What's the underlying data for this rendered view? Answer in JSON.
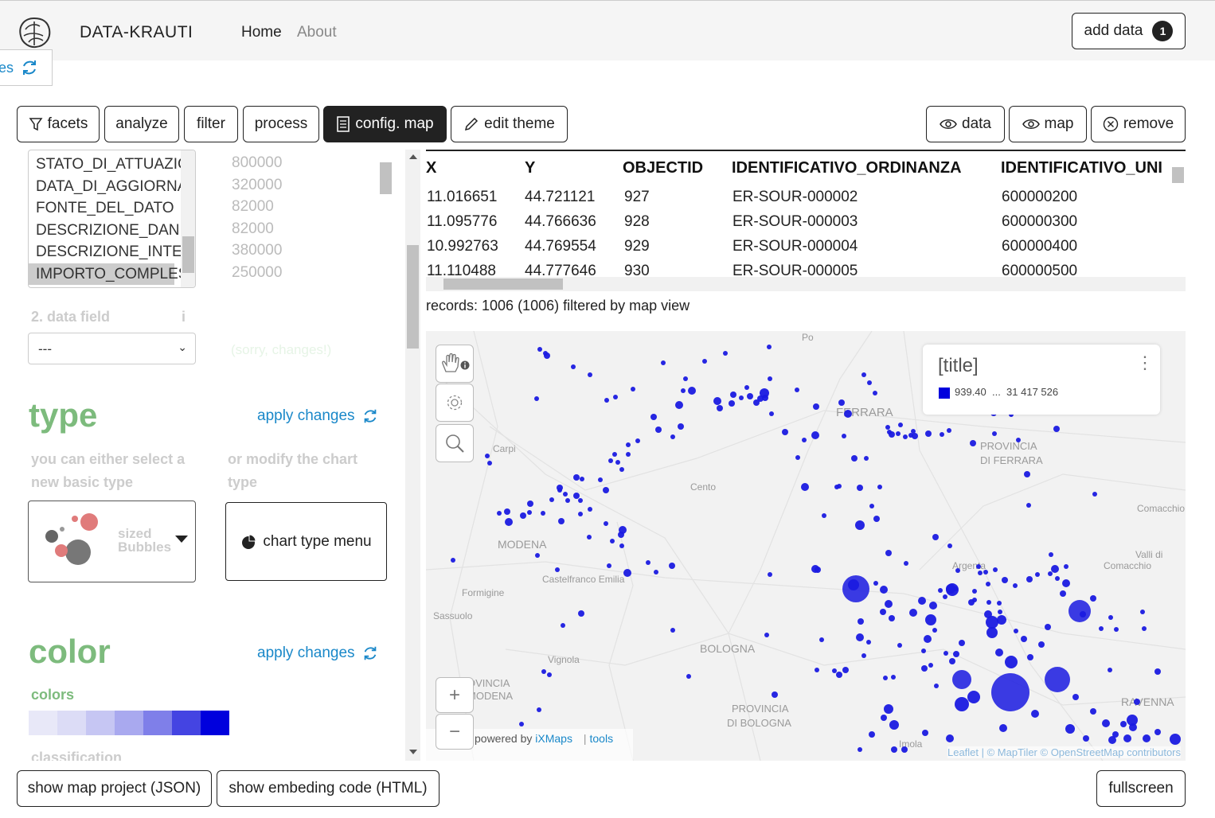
{
  "header": {
    "brand": "DATA-KRAUTI",
    "nav": [
      "Home",
      "About"
    ],
    "add_data_label": "add data",
    "add_data_count": "1",
    "side_tab_label": "es"
  },
  "toolbar": {
    "facets": "facets",
    "analyze": "analyze",
    "filter": "filter",
    "process": "process",
    "config_map": "config. map",
    "edit_theme": "edit theme",
    "data": "data",
    "map": "map",
    "remove": "remove"
  },
  "fields": {
    "items": [
      "STATO_DI_ATTUAZIC",
      "DATA_DI_AGGIORNA",
      "FONTE_DEL_DATO",
      "DESCRIZIONE_DANN",
      "DESCRIZIONE_INTER",
      "IMPORTO_COMPLES"
    ],
    "values": [
      "800000",
      "320000",
      "82000",
      "82000",
      "380000",
      "250000"
    ],
    "data_field_label": "2. data field",
    "info_icon": "i",
    "select_value": "---",
    "faded_hint": "(sorry, changes!)"
  },
  "type_section": {
    "title": "type",
    "apply": "apply changes",
    "hint_left": "you can either select a new basic type",
    "hint_right": "or modify the chart type",
    "selected_type": "sized Bubbles",
    "chart_menu": "chart type menu"
  },
  "color_section": {
    "title": "color",
    "apply": "apply changes",
    "colors_label": "colors",
    "palette": [
      "#e8e8f8",
      "#dcdcf6",
      "#c6c6f3",
      "#a9a9ef",
      "#7f7fe9",
      "#4444e2",
      "#0000dd"
    ],
    "classification_label": "classification"
  },
  "table": {
    "columns": [
      "X",
      "Y",
      "OBJECTID",
      "IDENTIFICATIVO_ORDINANZA",
      "IDENTIFICATIVO_UNI"
    ],
    "rows": [
      [
        "11.016651",
        "44.721121",
        "927",
        "ER-SOUR-000002",
        "600000200"
      ],
      [
        "11.095776",
        "44.766636",
        "928",
        "ER-SOUR-000003",
        "600000300"
      ],
      [
        "10.992763",
        "44.769554",
        "929",
        "ER-SOUR-000004",
        "600000400"
      ],
      [
        "11.110488",
        "44.777646",
        "930",
        "ER-SOUR-000005",
        "600000500"
      ]
    ],
    "records": "records: 1006 (1006) filtered by map view"
  },
  "map": {
    "legend_title": "[title]",
    "legend_range": "939.40  ...  31 417 526",
    "legend_color": "#0000dd",
    "places": [
      "FERRARA",
      "PROVINCIA",
      "DI FERRARA",
      "Carpi",
      "Cento",
      "MODENA",
      "Castelfranco Emilia",
      "Formigine",
      "Sassuolo",
      "BOLOGNA",
      "Vignola",
      "PROVINCIA",
      "DI BOLOGNA",
      "Argenta",
      "Comacchio",
      "Valli di",
      "Comacchio",
      "RAVENNA",
      "Po",
      "OVINCIA",
      "MODENA",
      "Imola"
    ],
    "powered_by": "powered by ",
    "ixmaps": "iXMaps",
    "tools": "tools",
    "attribution": "Leaflet | © MapTiler © OpenStreetMap contributors",
    "zoom_in": "+",
    "zoom_out": "−",
    "bubble_color": "#1a1ae0"
  },
  "footer": {
    "show_project": "show map project (JSON)",
    "show_embed": "show embeding code (HTML)",
    "fullscreen": "fullscreen"
  }
}
